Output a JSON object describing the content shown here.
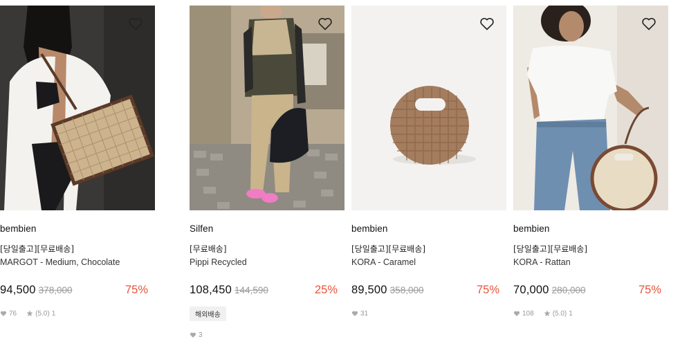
{
  "products": [
    {
      "brand": "Silfen",
      "tag": "[무료배송]",
      "name": "Pippi Recycled",
      "price": "108,450",
      "original_price": "144,590",
      "discount": "25%",
      "badge": "해외배송",
      "likes": "3",
      "rating": null,
      "reviews": null,
      "image": "woman-in-beige-vest-with-black-bag"
    },
    {
      "brand": "bembien",
      "tag": "[당일출고][무료배송]",
      "name": "KORA - Caramel",
      "price": "89,500",
      "original_price": "358,000",
      "discount": "75%",
      "badge": null,
      "likes": "31",
      "rating": null,
      "reviews": null,
      "image": "woven-round-caramel-bag"
    },
    {
      "brand": "bembien",
      "tag": "[당일출고][무료배송]",
      "name": "KORA - Rattan",
      "price": "70,000",
      "original_price": "280,000",
      "discount": "75%",
      "badge": null,
      "likes": "108",
      "rating": "(5.0)",
      "reviews": "1",
      "image": "woman-holding-round-rattan-bag"
    },
    {
      "brand": "bembien",
      "tag": "[당일출고][무료배송]",
      "name": "MARGOT - Medium, Chocolate",
      "price": "94,500",
      "original_price": "378,000",
      "discount": "75%",
      "badge": null,
      "likes": "76",
      "rating": "(5.0)",
      "reviews": "1",
      "image": "woman-with-rattan-tote"
    }
  ],
  "icons": {
    "wishlist": "heart-outline-icon",
    "likes": "heart-icon",
    "rating": "star-icon"
  },
  "colors": {
    "discount": "#e8533a",
    "original_price": "#999999",
    "badge_bg": "#f0f0f0"
  }
}
